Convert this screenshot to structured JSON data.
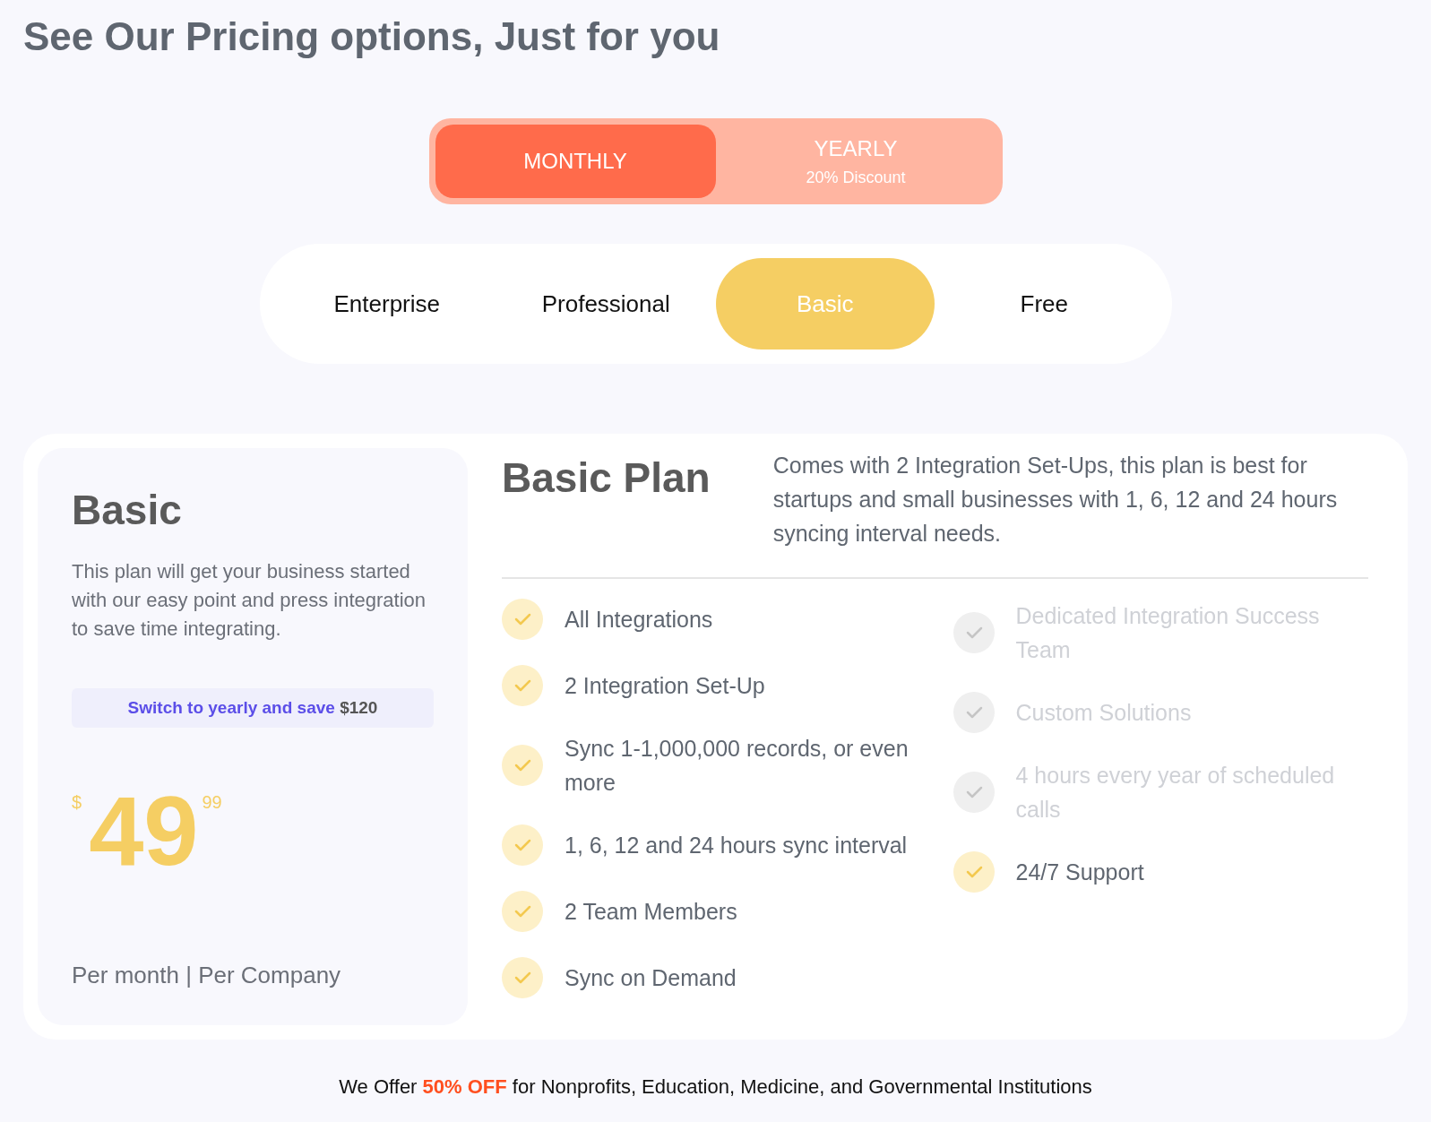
{
  "title": "See Our Pricing options, Just for you",
  "billing": [
    {
      "label": "MONTHLY",
      "selected": true
    },
    {
      "label": "YEARLY",
      "note": "20% Discount",
      "selected": false
    }
  ],
  "plans": [
    {
      "label": "Enterprise",
      "selected": false
    },
    {
      "label": "Professional",
      "selected": false
    },
    {
      "label": "Basic",
      "selected": true
    },
    {
      "label": "Free",
      "selected": false
    }
  ],
  "summary": {
    "name": "Basic",
    "description": "This plan will get your business started with our easy point and press integration to save time integrating.",
    "save_text": "Switch to yearly and save",
    "save_amount": "$120",
    "currency": "$",
    "price": "49",
    "cents": "99",
    "period": "Per month | Per Company"
  },
  "details": {
    "heading": "Basic Plan",
    "description": "Comes with 2 Integration Set-Ups, this plan is best for startups and small businesses with 1, 6, 12 and 24 hours syncing interval needs.",
    "columns": [
      [
        {
          "label": "All Integrations",
          "included": true
        },
        {
          "label": "2 Integration Set-Up",
          "included": true
        },
        {
          "label": "Sync 1-1,000,000 records, or even more",
          "included": true
        },
        {
          "label": "1, 6, 12 and 24 hours sync interval",
          "included": true
        },
        {
          "label": "2 Team Members",
          "included": true
        },
        {
          "label": "Sync on Demand",
          "included": true
        }
      ],
      [
        {
          "label": "Dedicated Integration Success Team",
          "included": false
        },
        {
          "label": "Custom Solutions",
          "included": false
        },
        {
          "label": "4 hours every year of scheduled calls",
          "included": false
        },
        {
          "label": "24/7 Support",
          "included": true
        }
      ]
    ]
  },
  "footer": {
    "prefix": "We Offer",
    "highlight": "50% OFF",
    "suffix": "for Nonprofits, Education, Medicine, and Governmental Institutions"
  }
}
